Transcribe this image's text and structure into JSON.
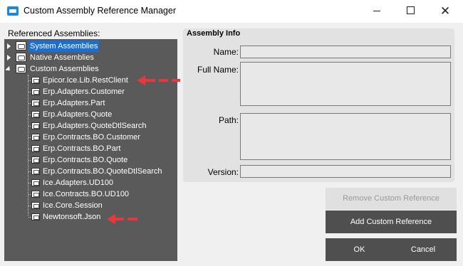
{
  "window": {
    "title": "Custom Assembly Reference Manager",
    "minimize_label": "",
    "close_glyph": "✕"
  },
  "referenced": {
    "label": "Referenced Assemblies:",
    "groups": [
      {
        "label": "System Assemblies",
        "selected": true,
        "expanded": false
      },
      {
        "label": "Native Assemblies",
        "selected": false,
        "expanded": false
      },
      {
        "label": "Custom Assemblies",
        "selected": false,
        "expanded": true
      }
    ],
    "custom_items": [
      "Epicor.Ice.Lib.RestClient",
      "Erp.Adapters.Customer",
      "Erp.Adapters.Part",
      "Erp.Adapters.Quote",
      "Erp.Adapters.QuoteDtlSearch",
      "Erp.Contracts.BO.Customer",
      "Erp.Contracts.BO.Part",
      "Erp.Contracts.BO.Quote",
      "Erp.Contracts.BO.QuoteDtlSearch",
      "Ice.Adapters.UD100",
      "Ice.Contracts.BO.UD100",
      "Ice.Core.Session",
      "Newtonsoft.Json"
    ]
  },
  "assembly_info": {
    "title": "Assembly Info",
    "name_label": "Name:",
    "full_name_label": "Full Name:",
    "path_label": "Path:",
    "version_label": "Version:",
    "name_value": "",
    "full_name_value": "",
    "path_value": "",
    "version_value": ""
  },
  "buttons": {
    "remove": "Remove Custom Reference",
    "add": "Add Custom Reference",
    "ok": "OK",
    "cancel": "Cancel"
  },
  "colors": {
    "tree_bg": "#5a5a5a",
    "selection": "#1a6fd6",
    "annotation_arrow": "#e8383d",
    "dark_button": "#4f4f4f"
  }
}
